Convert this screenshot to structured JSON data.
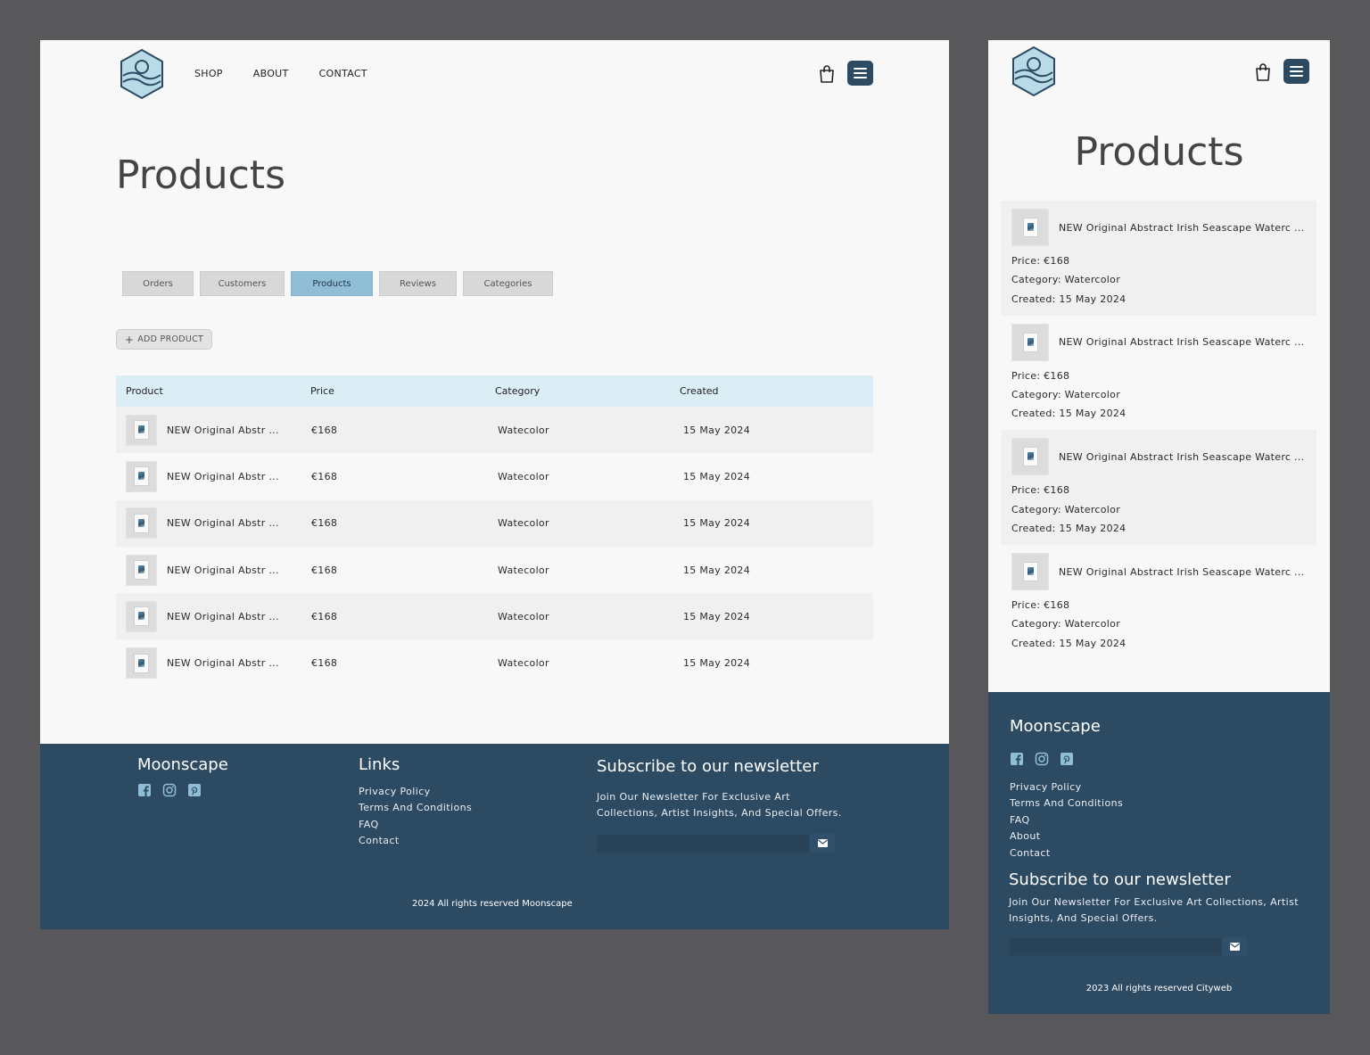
{
  "desktop": {
    "nav": {
      "links": [
        "SHOP",
        "ABOUT",
        "CONTACT"
      ]
    },
    "page_title": "Products",
    "tabs": [
      {
        "label": "Orders",
        "active": false
      },
      {
        "label": "Customers",
        "active": false
      },
      {
        "label": "Products",
        "active": true
      },
      {
        "label": "Reviews",
        "active": false
      },
      {
        "label": "Categories",
        "active": false
      }
    ],
    "add_button": "ADD PRODUCT",
    "table": {
      "headers": [
        "Product",
        "Price",
        "Category",
        "Created"
      ],
      "rows": [
        {
          "product": "NEW Original Abstr ...",
          "price": "€168",
          "category": "Watecolor",
          "created": "15 May 2024"
        },
        {
          "product": "NEW Original Abstr ...",
          "price": "€168",
          "category": "Watecolor",
          "created": "15 May 2024"
        },
        {
          "product": "NEW Original Abstr ...",
          "price": "€168",
          "category": "Watecolor",
          "created": "15 May 2024"
        },
        {
          "product": "NEW Original Abstr ...",
          "price": "€168",
          "category": "Watecolor",
          "created": "15 May 2024"
        },
        {
          "product": "NEW Original Abstr ...",
          "price": "€168",
          "category": "Watecolor",
          "created": "15 May 2024"
        },
        {
          "product": "NEW Original Abstr ...",
          "price": "€168",
          "category": "Watecolor",
          "created": "15 May 2024"
        }
      ]
    },
    "footer": {
      "brand": "Moonscape",
      "links_title": "Links",
      "links": [
        "Privacy Policy",
        "Terms And Conditions",
        "FAQ",
        "Contact"
      ],
      "newsletter_title": "Subscribe to our newsletter",
      "newsletter_text": "Join Our Newsletter For Exclusive Art Collections, Artist Insights, And Special Offers.",
      "copyright": "2024 All rights reserved Moonscape"
    }
  },
  "mobile": {
    "page_title": "Products",
    "cards": [
      {
        "name": "NEW Original Abstract Irish Seascape Waterc ...",
        "price": "Price: €168",
        "category": "Category: Watercolor",
        "created": "Created: 15 May 2024"
      },
      {
        "name": "NEW Original Abstract Irish Seascape Waterc ...",
        "price": "Price: €168",
        "category": "Category: Watercolor",
        "created": "Created: 15 May 2024"
      },
      {
        "name": "NEW Original Abstract Irish Seascape Waterc ...",
        "price": "Price: €168",
        "category": "Category: Watercolor",
        "created": "Created: 15 May 2024"
      },
      {
        "name": "NEW Original Abstract Irish Seascape Waterc ...",
        "price": "Price: €168",
        "category": "Category: Watercolor",
        "created": "Created: 15 May 2024"
      }
    ],
    "footer": {
      "brand": "Moonscape",
      "links": [
        "Privacy Policy",
        "Terms And Conditions",
        "FAQ",
        "About",
        "Contact"
      ],
      "newsletter_title": "Subscribe to our newsletter",
      "newsletter_text": "Join Our Newsletter For Exclusive Art Collections, Artist Insights, And Special Offers.",
      "copyright": "2023 All rights reserved Cityweb"
    }
  },
  "icons": {
    "logo": "moonscape-hexagon-logo",
    "cart": "shopping-bag-icon",
    "menu": "hamburger-menu-icon",
    "add": "plus-icon",
    "socials": [
      "facebook-icon",
      "instagram-icon",
      "pinterest-icon"
    ],
    "send": "envelope-icon"
  },
  "colors": {
    "primary": "#2d4a63",
    "accent": "#8fbed6",
    "table_header": "#dbedf5",
    "background": "#f8f8f8",
    "canvas": "#58585a"
  }
}
